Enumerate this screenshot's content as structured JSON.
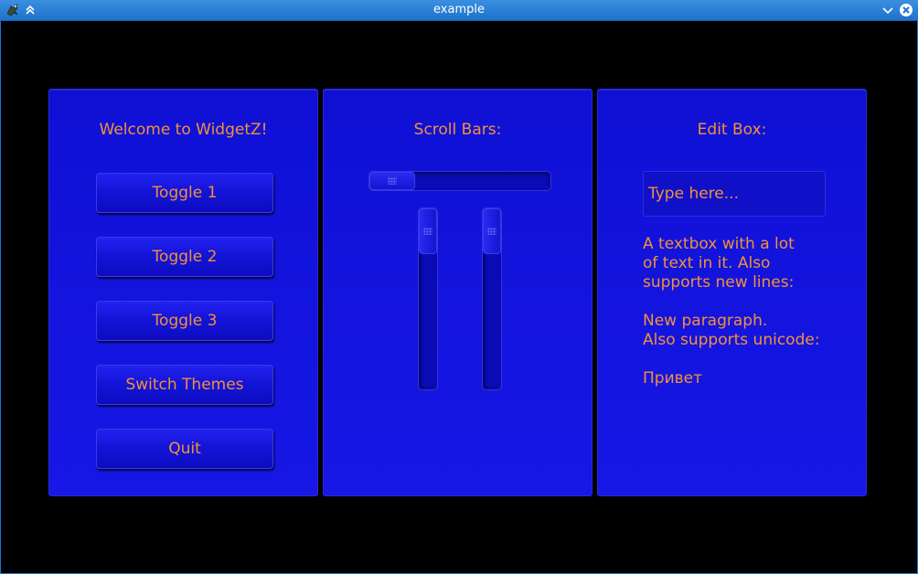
{
  "window": {
    "title": "example"
  },
  "panels": {
    "left": {
      "title": "Welcome to WidgetZ!",
      "buttons": [
        "Toggle 1",
        "Toggle 2",
        "Toggle 3",
        "Switch Themes",
        "Quit"
      ]
    },
    "middle": {
      "title": "Scroll Bars:",
      "horizontal_scroll": {
        "position": 0.0
      },
      "vertical_scrolls": [
        {
          "position": 0.0
        },
        {
          "position": 0.0
        }
      ]
    },
    "right": {
      "title": "Edit Box:",
      "edit_placeholder": "Type here...",
      "text": "A textbox with a lot\nof text in it. Also\nsupports new lines:\n\nNew paragraph.\nAlso supports unicode:\n\nПривет"
    }
  },
  "colors": {
    "panel": "#1414dc",
    "text": "#f2913a",
    "titlebar": "#2a7fd6"
  }
}
